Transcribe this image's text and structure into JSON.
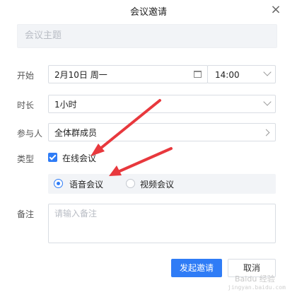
{
  "dialog": {
    "title": "会议邀请",
    "close_icon": "×"
  },
  "subject": {
    "placeholder": "会议主题"
  },
  "start": {
    "label": "开始",
    "date": "2月10日 周一",
    "time": "14:00"
  },
  "duration": {
    "label": "时长",
    "value": "1小时"
  },
  "participants": {
    "label": "参与人",
    "value": "全体群成员"
  },
  "type": {
    "label": "类型",
    "online_label": "在线会议",
    "online_checked": true,
    "options": [
      {
        "label": "语音会议",
        "selected": true
      },
      {
        "label": "视频会议",
        "selected": false
      }
    ]
  },
  "notes": {
    "label": "备注",
    "placeholder": "请输入备注"
  },
  "buttons": {
    "send": "发起邀请",
    "cancel": "取消"
  },
  "colors": {
    "accent": "#2f7cf6",
    "arrow": "#e8383d"
  },
  "watermark": {
    "line1": "Baidu 经验",
    "line2": "jingyan.baidu.com"
  }
}
